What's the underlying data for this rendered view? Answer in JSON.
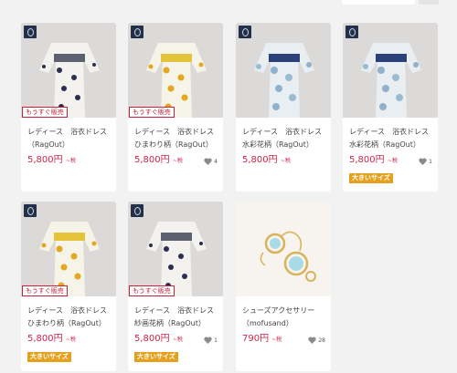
{
  "labels": {
    "soon": "もうすぐ販売",
    "big_size": "大きいサイズ",
    "tax": "~税"
  },
  "colors": {
    "price": "#d1234a",
    "soon_border": "#c0243c",
    "big_badge_bg": "#e5a11d",
    "photo_bg": "#dcdad8"
  },
  "products": [
    {
      "title1": "レディース　浴衣ドレス",
      "title2": "（RagOut）",
      "price": "5,800円",
      "likes": "",
      "big_size": false,
      "soon": true,
      "pattern": "navy-floral"
    },
    {
      "title1": "レディース　浴衣ドレス",
      "title2": "ひまわり柄（RagOut）",
      "price": "5,800円",
      "likes": "4",
      "big_size": false,
      "soon": true,
      "pattern": "sunflower"
    },
    {
      "title1": "レディース　浴衣ドレス",
      "title2": "水彩花柄（RagOut）",
      "price": "5,800円",
      "likes": "",
      "big_size": false,
      "soon": false,
      "pattern": "watercolor"
    },
    {
      "title1": "レディース　浴衣ドレス",
      "title2": "水彩花柄（RagOut）",
      "price": "5,800円",
      "likes": "1",
      "big_size": true,
      "soon": false,
      "pattern": "watercolor"
    },
    {
      "title1": "レディース　浴衣ドレス",
      "title2": "ひまわり柄（RagOut）",
      "price": "5,800円",
      "likes": "",
      "big_size": true,
      "soon": true,
      "pattern": "sunflower"
    },
    {
      "title1": "レディース　浴衣ドレス",
      "title2": "紗画花柄（RagOut）",
      "price": "5,800円",
      "likes": "1",
      "big_size": true,
      "soon": true,
      "pattern": "navy-floral"
    },
    {
      "title1": "シューズアクセサリー",
      "title2": "（mofusand）",
      "price": "790円",
      "likes": "28",
      "big_size": false,
      "soon": false,
      "pattern": "accessory"
    }
  ]
}
